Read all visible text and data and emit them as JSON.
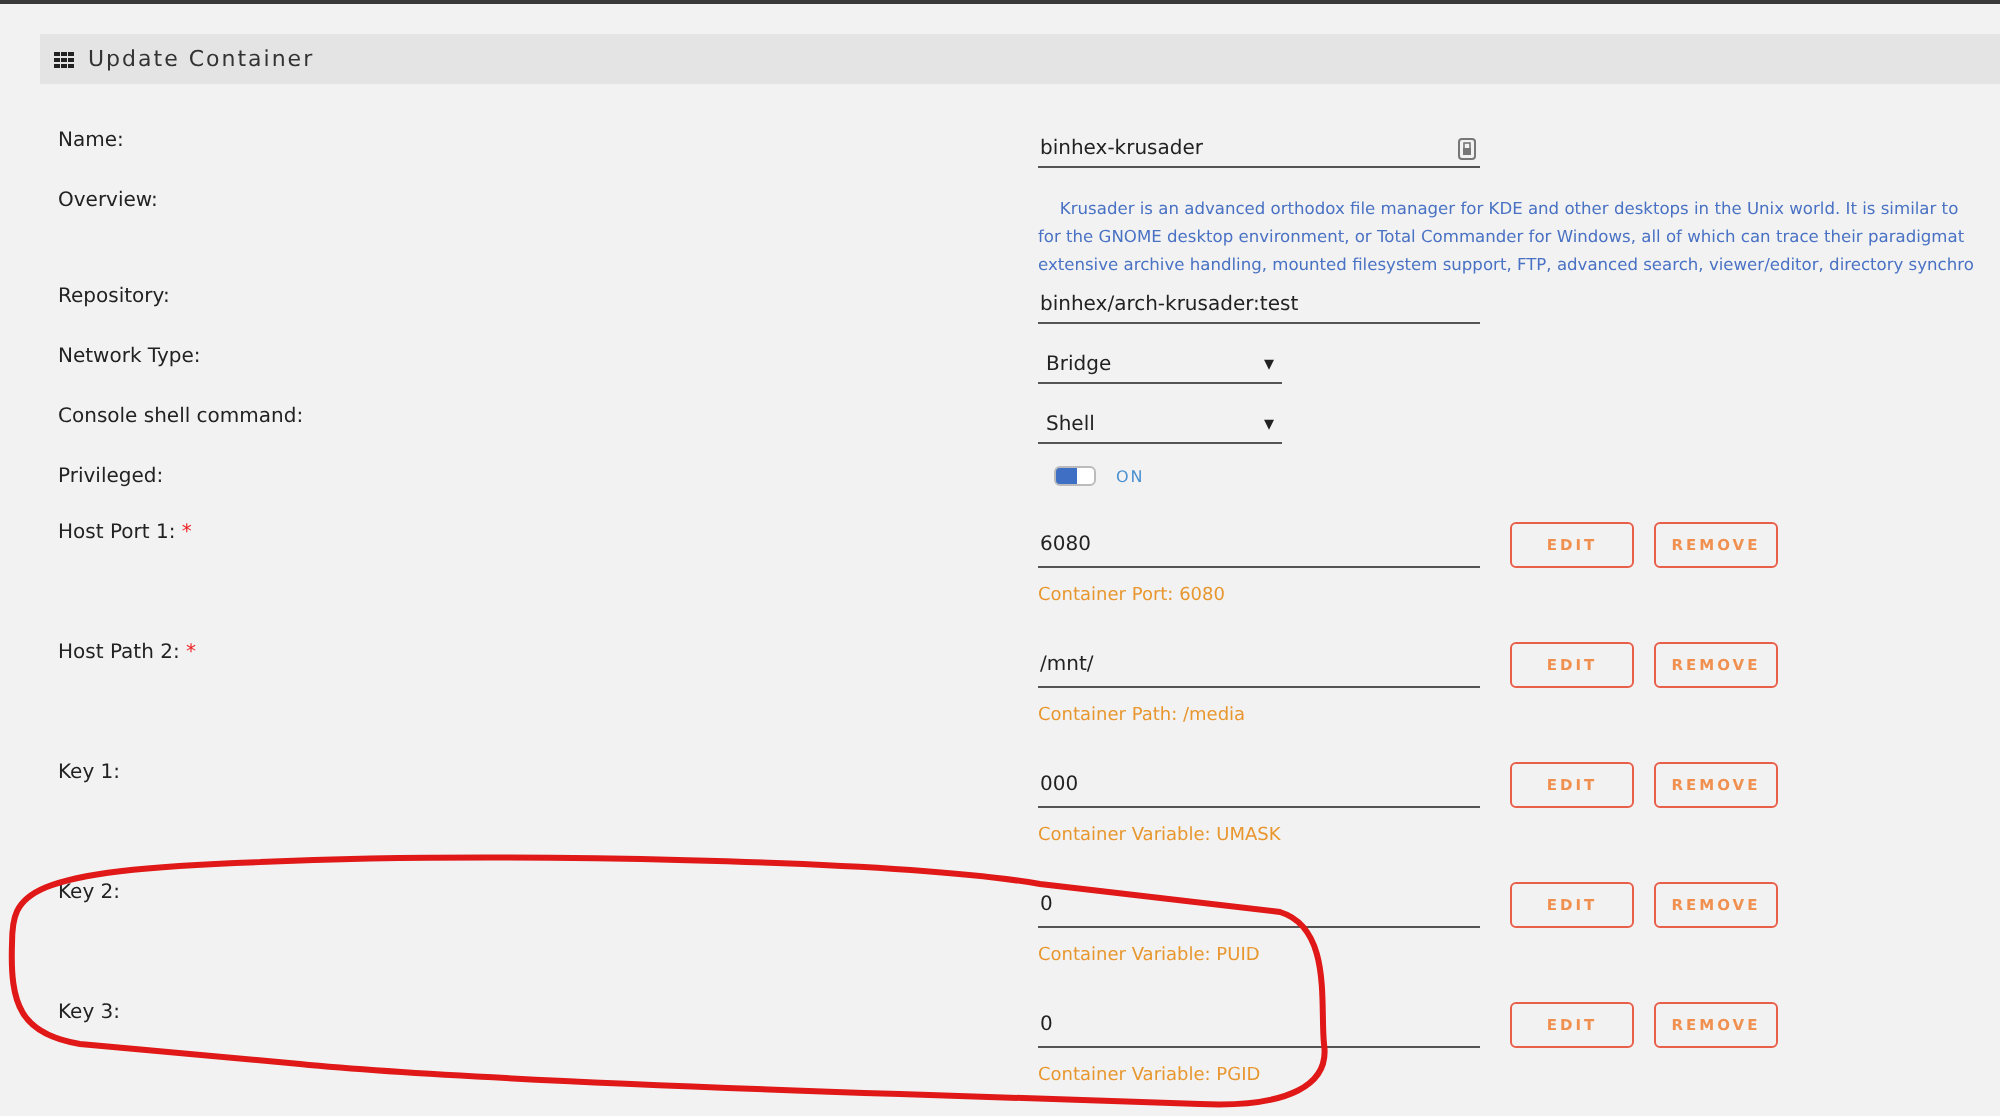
{
  "header": {
    "title": "Update Container"
  },
  "fields": [
    {
      "kind": "text",
      "label": "Name:",
      "value": "binhex-krusader"
    },
    {
      "kind": "overview",
      "label": "Overview:",
      "lines": [
        "Krusader is an advanced orthodox file manager for KDE and other desktops in the Unix world. It is similar to",
        "for the GNOME desktop environment, or Total Commander for Windows, all of which can trace their paradigmat",
        "extensive archive handling, mounted filesystem support, FTP, advanced search, viewer/editor, directory synchro"
      ]
    },
    {
      "kind": "text",
      "label": "Repository:",
      "value": "binhex/arch-krusader:test"
    },
    {
      "kind": "select",
      "label": "Network Type:",
      "value": "Bridge",
      "caret": "▾"
    },
    {
      "kind": "select",
      "label": "Console shell command:",
      "value": "Shell",
      "caret": "▾"
    },
    {
      "kind": "toggle",
      "label": "Privileged:",
      "on": true,
      "state_label": "ON"
    }
  ],
  "config_items": [
    {
      "label": "Host Port 1:",
      "required_mark": "*",
      "value": "6080",
      "hint": "Container Port: 6080",
      "buttons": [
        "EDIT",
        "REMOVE"
      ]
    },
    {
      "label": "Host Path 2:",
      "required_mark": "*",
      "value": "/mnt/",
      "hint": "Container Path: /media",
      "buttons": [
        "EDIT",
        "REMOVE"
      ]
    },
    {
      "label": "Key 1:",
      "value": "000",
      "hint": "Container Variable: UMASK",
      "buttons": [
        "EDIT",
        "REMOVE"
      ]
    },
    {
      "label": "Key 2:",
      "value": "0",
      "hint": "Container Variable: PUID",
      "buttons": [
        "EDIT",
        "REMOVE"
      ]
    },
    {
      "label": "Key 3:",
      "value": "0",
      "hint": "Container Variable: PGID",
      "buttons": [
        "EDIT",
        "REMOVE"
      ]
    }
  ]
}
